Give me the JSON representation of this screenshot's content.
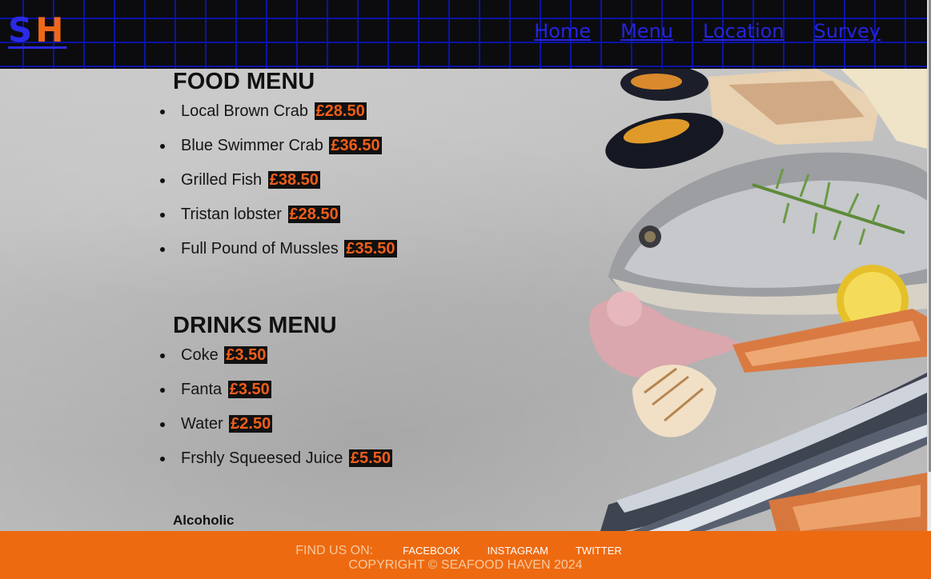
{
  "header": {
    "logo": {
      "letter1": "S",
      "letter2": "H"
    },
    "nav": [
      "Home",
      "Menu",
      "Location",
      "Survey"
    ]
  },
  "food_menu": {
    "title": "FOOD MENU",
    "items": [
      {
        "name": "Local Brown Crab",
        "price": "£28.50"
      },
      {
        "name": "Blue Swimmer Crab",
        "price": "£36.50"
      },
      {
        "name": "Grilled Fish",
        "price": "£38.50"
      },
      {
        "name": "Tristan lobster",
        "price": "£28.50"
      },
      {
        "name": "Full Pound of Mussles",
        "price": "£35.50"
      }
    ]
  },
  "drinks_menu": {
    "title": "DRINKS MENU",
    "items": [
      {
        "name": "Coke",
        "price": "£3.50"
      },
      {
        "name": "Fanta",
        "price": "£3.50"
      },
      {
        "name": "Water",
        "price": "£2.50"
      },
      {
        "name": "Frshly Squeesed Juice",
        "price": "£5.50"
      }
    ],
    "subheading": "Alcoholic"
  },
  "footer": {
    "find_label": "FIND US ON:",
    "social": [
      "FACEBOOK",
      "INSTAGRAM",
      "TWITTER"
    ],
    "copyright": "COPYRIGHT © SEAFOOD HAVEN 2024"
  },
  "colors": {
    "accent_orange": "#ee6a10",
    "nav_blue": "#2424e0",
    "header_bg": "#0c0c0e",
    "price_text": "#ef5e1a"
  }
}
